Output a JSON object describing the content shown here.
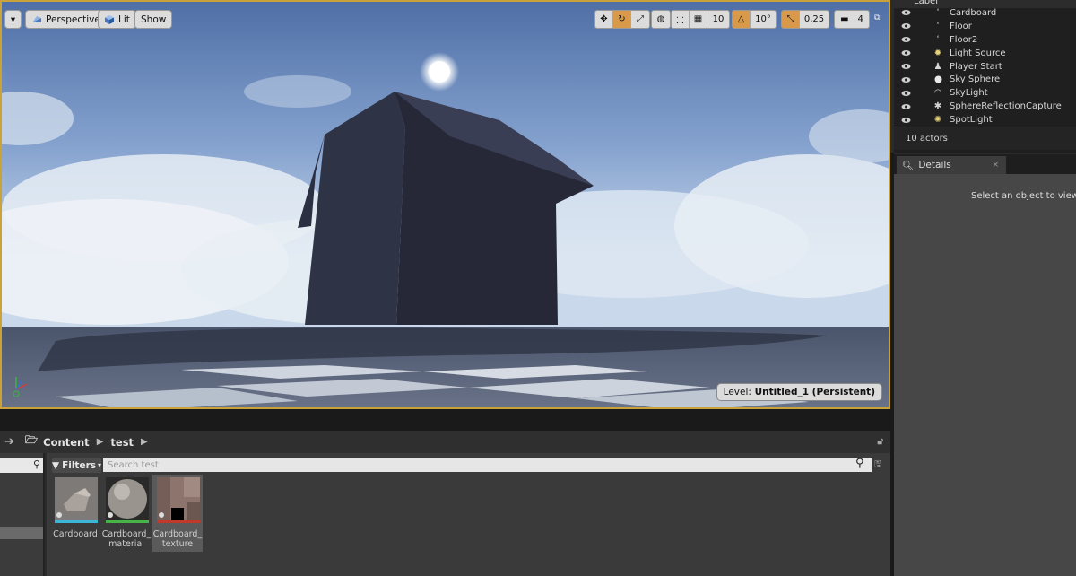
{
  "viewport": {
    "menu_arrow": "▾",
    "perspective_label": "Perspective",
    "lit_label": "Lit",
    "show_label": "Show",
    "grid_snap_value": "10",
    "rotation_snap_value": "10°",
    "scale_snap_value": "0,25",
    "camera_speed_value": "4",
    "level_prefix": "Level:",
    "level_name": "Untitled_1 (Persistent)"
  },
  "outliner": {
    "header_label": "Label",
    "actors": [
      {
        "label": "Cardboard",
        "icon": "static-mesh-icon"
      },
      {
        "label": "Floor",
        "icon": "static-mesh-icon"
      },
      {
        "label": "Floor2",
        "icon": "static-mesh-icon"
      },
      {
        "label": "Light Source",
        "icon": "directional-light-icon"
      },
      {
        "label": "Player Start",
        "icon": "player-start-icon"
      },
      {
        "label": "Sky Sphere",
        "icon": "sphere-icon"
      },
      {
        "label": "SkyLight",
        "icon": "skylight-icon"
      },
      {
        "label": "SphereReflectionCapture",
        "icon": "reflection-capture-icon"
      },
      {
        "label": "SpotLight",
        "icon": "spotlight-icon"
      }
    ],
    "actor_count": "10 actors"
  },
  "details": {
    "tab_label": "Details",
    "close_glyph": "×",
    "empty_message": "Select an object to view de"
  },
  "content_browser": {
    "path": [
      "Content",
      "test"
    ],
    "filters_label": "Filters",
    "search_placeholder": "Search test",
    "assets": [
      {
        "name": "Cardboard",
        "type_color": "#3bb6d6"
      },
      {
        "name": "Cardboard_ material",
        "type_color": "#46b446"
      },
      {
        "name": "Cardboard_ texture",
        "type_color": "#c0392b"
      }
    ]
  },
  "colors": {
    "viewport_border": "#c9a23a",
    "snap_active": "#d89a4a"
  }
}
